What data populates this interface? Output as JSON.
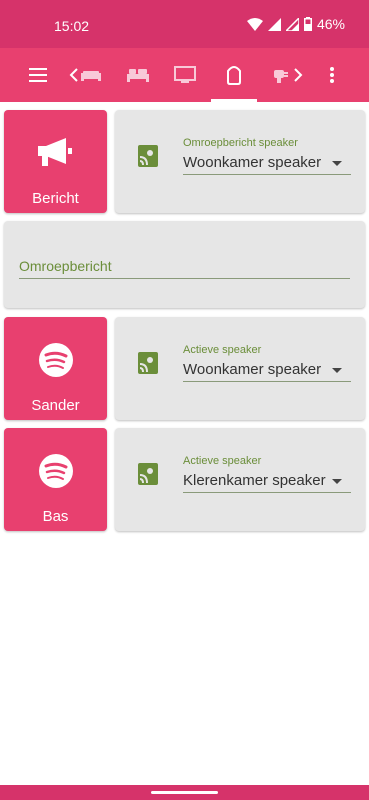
{
  "status": {
    "time": "15:02",
    "battery": "46%"
  },
  "nav": {
    "tabs": [
      "menu",
      "back-sofa",
      "bed",
      "tv",
      "speaker",
      "plug-forward",
      "more"
    ],
    "active_tab": "speaker"
  },
  "cards": {
    "bericht": {
      "label": "Bericht",
      "icon": "megaphone-icon"
    },
    "omroep_select": {
      "label": "Omroepbericht speaker",
      "value": "Woonkamer speaker"
    },
    "input": {
      "label": "Omroepbericht"
    },
    "sander": {
      "label": "Sander",
      "icon": "spotify-icon"
    },
    "sander_select": {
      "label": "Actieve speaker",
      "value": "Woonkamer speaker"
    },
    "bas": {
      "label": "Bas",
      "icon": "spotify-icon"
    },
    "bas_select": {
      "label": "Actieve speaker",
      "value": "Klerenkamer speaker"
    }
  },
  "colors": {
    "primary": "#e8406f",
    "status": "#d6336a",
    "accent": "#6b8e3a",
    "card": "#e6e6e6"
  }
}
